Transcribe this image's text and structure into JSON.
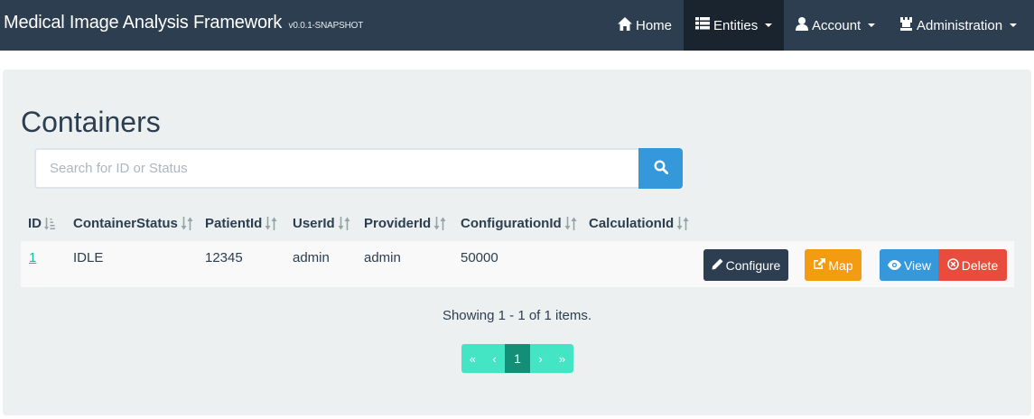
{
  "app": {
    "brand": "Medical Image Analysis Framework",
    "version": "v0.0.1-SNAPSHOT"
  },
  "nav": {
    "home": "Home",
    "entities": "Entities",
    "account": "Account",
    "administration": "Administration"
  },
  "page": {
    "title": "Containers"
  },
  "search": {
    "placeholder": "Search for ID or Status",
    "value": ""
  },
  "table": {
    "headers": [
      "ID",
      "ContainerStatus",
      "PatientId",
      "UserId",
      "ProviderId",
      "ConfigurationId",
      "CalculationId"
    ],
    "rows": [
      {
        "id": "1",
        "container_status": "IDLE",
        "patient_id": "12345",
        "user_id": "admin",
        "provider_id": "admin",
        "configuration_id": "50000",
        "calculation_id": ""
      }
    ],
    "actions": {
      "configure": "Configure",
      "map": "Map",
      "view": "View",
      "delete": "Delete"
    }
  },
  "summary": "Showing 1 - 1 of 1 items.",
  "pagination": {
    "first": "«",
    "prev": "‹",
    "current": "1",
    "next": "›",
    "last": "»"
  },
  "colors": {
    "navbar": "#2c3e50",
    "primary": "#2c3e50",
    "info": "#3498db",
    "warning": "#f39c12",
    "danger": "#e74c3c",
    "success": "#18bc9c"
  },
  "icons": {
    "home": "home-icon",
    "entities": "th-list-icon",
    "account": "user-icon",
    "administration": "tower-icon",
    "search": "search-icon",
    "configure": "pencil-icon",
    "map": "share-icon",
    "view": "eye-icon",
    "delete": "remove-circle-icon"
  }
}
